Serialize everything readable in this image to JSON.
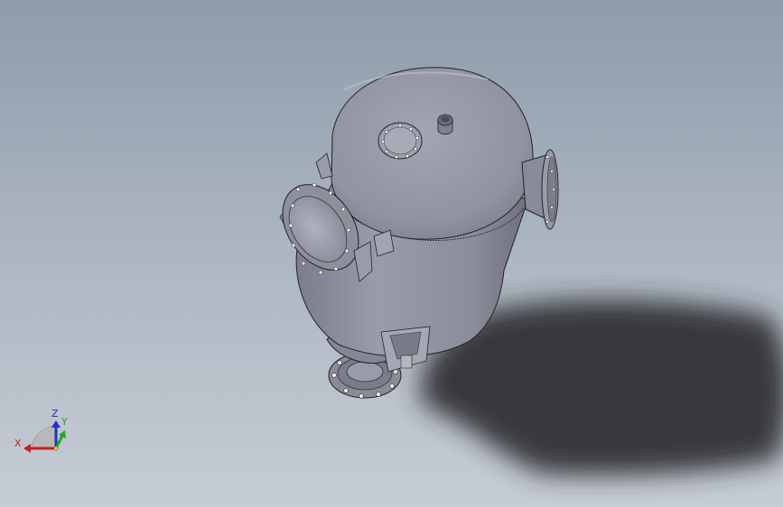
{
  "viewport": {
    "scene": "pressure-vessel-3d-model",
    "colors": {
      "background_top": "#8f9bab",
      "background_bottom": "#c6ccd4",
      "body": "#8e8f9e",
      "shadow": "#2a2b2f"
    }
  },
  "triad": {
    "x_label": "X",
    "y_label": "Y",
    "z_label": "Z",
    "colors": {
      "x": "#c81e1e",
      "y": "#1ea81e",
      "z": "#2030c8"
    }
  }
}
